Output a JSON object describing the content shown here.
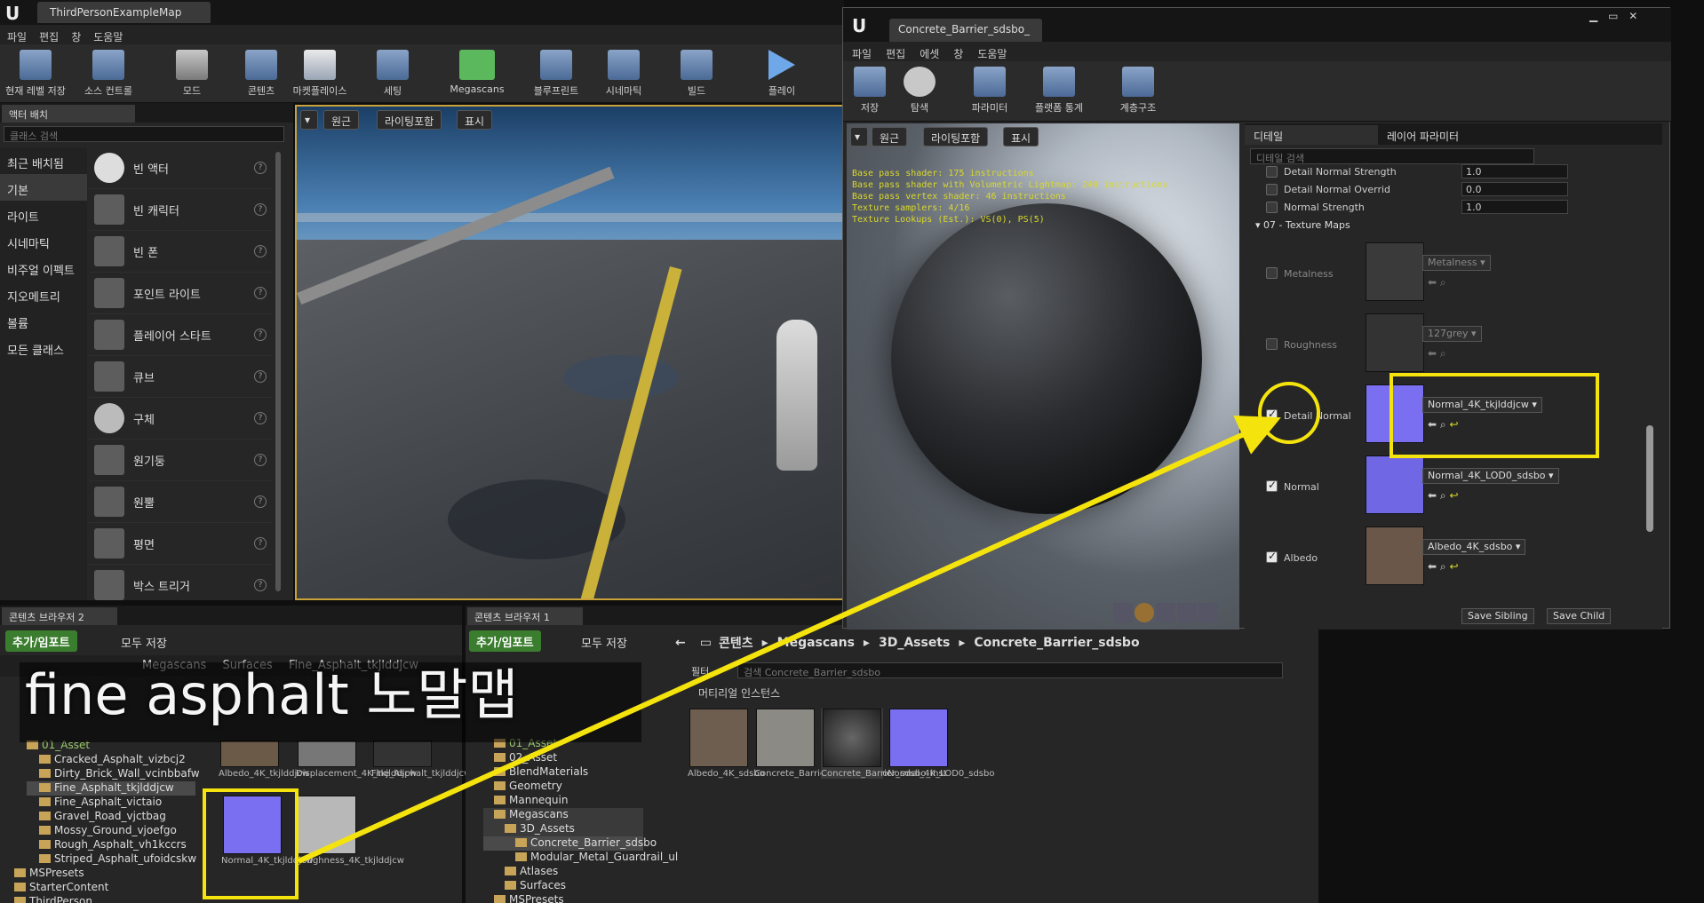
{
  "main_editor": {
    "title_tab": "ThirdPersonExampleMap",
    "menu": [
      "파일",
      "편집",
      "창",
      "도움말"
    ],
    "toolbar": [
      "현재 레벨 저장",
      "소스 컨트롤",
      "모드",
      "콘텐츠",
      "마켓플레이스",
      "세팅",
      "Megascans",
      "블루프린트",
      "시네마틱",
      "빌드",
      "플레이"
    ]
  },
  "place_panel": {
    "tab": "액터 배치",
    "search_placeholder": "클래스 검색",
    "categories": [
      "최근 배치됨",
      "기본",
      "라이트",
      "시네마틱",
      "비주얼 이펙트",
      "지오메트리",
      "볼륨",
      "모든 클래스"
    ],
    "items": [
      "빈 액터",
      "빈 캐릭터",
      "빈 폰",
      "포인트 라이트",
      "플레이어 스타트",
      "큐브",
      "구체",
      "원기둥",
      "원뿔",
      "평면",
      "박스 트리거"
    ]
  },
  "main_viewport": {
    "buttons": [
      "원근",
      "라이팅포함",
      "표시"
    ]
  },
  "content_browser_2": {
    "tab": "콘텐츠 브라우저 2",
    "add_import": "추가/임포트",
    "save_all": "모두 저장",
    "path": [
      "Megascans",
      "Surfaces",
      "Fine_Asphalt_tkjlddjcw"
    ],
    "tree": [
      "01_Asset",
      "Cracked_Asphalt_vizbcj2",
      "Dirty_Brick_Wall_vcinbbafw",
      "Fine_Asphalt_tkjlddjcw",
      "Fine_Asphalt_victaio",
      "Gravel_Road_vjctbag",
      "Mossy_Ground_vjoefgo",
      "Rough_Asphalt_vh1kccrs",
      "Striped_Asphalt_ufoidcskw",
      "MSPresets",
      "StarterContent",
      "ThirdPerson"
    ],
    "assets_top": [
      "Albedo_4K_tkjlddjcw",
      "Displacement_4K_tkjlddjcw",
      "Fine_Asphalt_tkjlddjcw_inst"
    ],
    "assets_bottom": [
      "Normal_4K_tkjlddjcw",
      "Roughness_4K_tkjlddjcw"
    ]
  },
  "content_browser_1": {
    "tab": "콘텐츠 브라우저 1",
    "add_import": "추가/임포트",
    "save_all": "모두 저장",
    "path": [
      "콘텐츠",
      "Megascans",
      "3D_Assets",
      "Concrete_Barrier_sdsbo"
    ],
    "filter": "필터",
    "search_placeholder": "검색 Concrete_Barrier_sdsbo",
    "section": "머티리얼 인스턴스",
    "tree": [
      "01_Asset",
      "02_Asset",
      "BlendMaterials",
      "Geometry",
      "Mannequin",
      "Megascans",
      "3D_Assets",
      "Concrete_Barrier_sdsbo",
      "Modular_Metal_Guardrail_ul",
      "Atlases",
      "Surfaces",
      "MSPresets"
    ],
    "assets": [
      "Albedo_4K_sdsbo",
      "Concrete_Barrier_LOD0_sdsbo",
      "Concrete_Barrier_sdsbo_inst",
      "Normal_4K_LOD0_sdsbo"
    ]
  },
  "material_editor": {
    "title_tab": "Concrete_Barrier_sdsbo_",
    "menu": [
      "파일",
      "편집",
      "에셋",
      "창",
      "도움말"
    ],
    "toolbar": [
      "저장",
      "탐색",
      "파라미터",
      "플랫폼 통계",
      "계층구조"
    ],
    "viewport_buttons": [
      "원근",
      "라이팅포함",
      "표시"
    ],
    "stats": [
      "Base pass shader: 175 instructions",
      "Base pass shader with Volumetric Lightmap: 249 instructions",
      "Base pass vertex shader: 46 instructions",
      "Texture samplers: 4/16",
      "Texture Lookups (Est.): VS(0), PS(5)"
    ],
    "tabs": [
      "디테일",
      "레이어 파라미터"
    ],
    "search_placeholder": "디테일 검색",
    "scalar_rows": [
      {
        "label": "Detail Normal Strength",
        "value": "1.0"
      },
      {
        "label": "Detail Normal  Overrid",
        "value": "0.0"
      },
      {
        "label": "Normal Strength",
        "value": "1.0"
      }
    ],
    "group": "07 - Texture Maps",
    "texture_rows": [
      {
        "label": "Metalness",
        "texture": "Metalness",
        "checked": false
      },
      {
        "label": "Roughness",
        "texture": "127grey",
        "checked": false
      },
      {
        "label": "Detail Normal",
        "texture": "Normal_4K_tkjlddjcw",
        "checked": true
      },
      {
        "label": "Normal",
        "texture": "Normal_4K_LOD0_sdsbo",
        "checked": true
      },
      {
        "label": "Albedo",
        "texture": "Albedo_4K_sdsbo",
        "checked": true
      }
    ],
    "save_sibling": "Save Sibling",
    "save_child": "Save Child"
  },
  "subtitle": "fine asphalt 노말맵",
  "colors": {
    "highlight": "#f5e30d",
    "add_button": "#3b7d2e",
    "selection": "#c9a23a"
  }
}
